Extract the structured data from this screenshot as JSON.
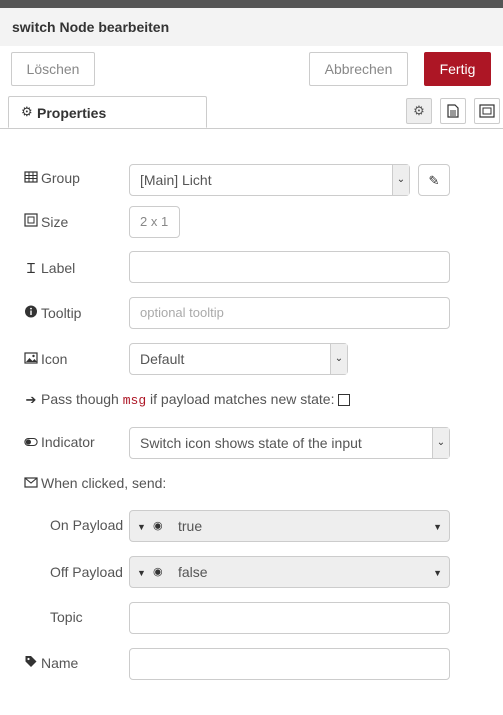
{
  "header": {
    "title": "switch Node bearbeiten"
  },
  "buttons": {
    "delete": "Löschen",
    "cancel": "Abbrechen",
    "done": "Fertig"
  },
  "tabs": {
    "properties": "Properties"
  },
  "form": {
    "group": {
      "label": "Group",
      "value": "[Main] Licht"
    },
    "size": {
      "label": "Size",
      "value": "2 x 1"
    },
    "label": {
      "label": "Label",
      "value": ""
    },
    "tooltip": {
      "label": "Tooltip",
      "placeholder": "optional tooltip"
    },
    "icon": {
      "label": "Icon",
      "value": "Default"
    },
    "passthrough": {
      "prefix": "Pass though",
      "code": "msg",
      "suffix": "if payload matches new state:"
    },
    "indicator": {
      "label": "Indicator",
      "value": "Switch icon shows state of the input"
    },
    "when_clicked": {
      "label": "When clicked, send:"
    },
    "on_payload": {
      "label": "On Payload",
      "value": "true"
    },
    "off_payload": {
      "label": "Off Payload",
      "value": "false"
    },
    "topic": {
      "label": "Topic",
      "value": ""
    },
    "name": {
      "label": "Name",
      "value": ""
    }
  },
  "icons": [
    "gear-icon",
    "document-icon",
    "frame-icon",
    "table-icon",
    "resize-icon",
    "text-cursor-icon",
    "info-icon",
    "image-icon",
    "arrow-right-icon",
    "toggle-icon",
    "envelope-icon",
    "tag-icon",
    "pencil-icon",
    "radio-icon",
    "caret-down-icon"
  ],
  "colors": {
    "accent": "#ad1625",
    "header_bg": "#f3f3f3"
  }
}
